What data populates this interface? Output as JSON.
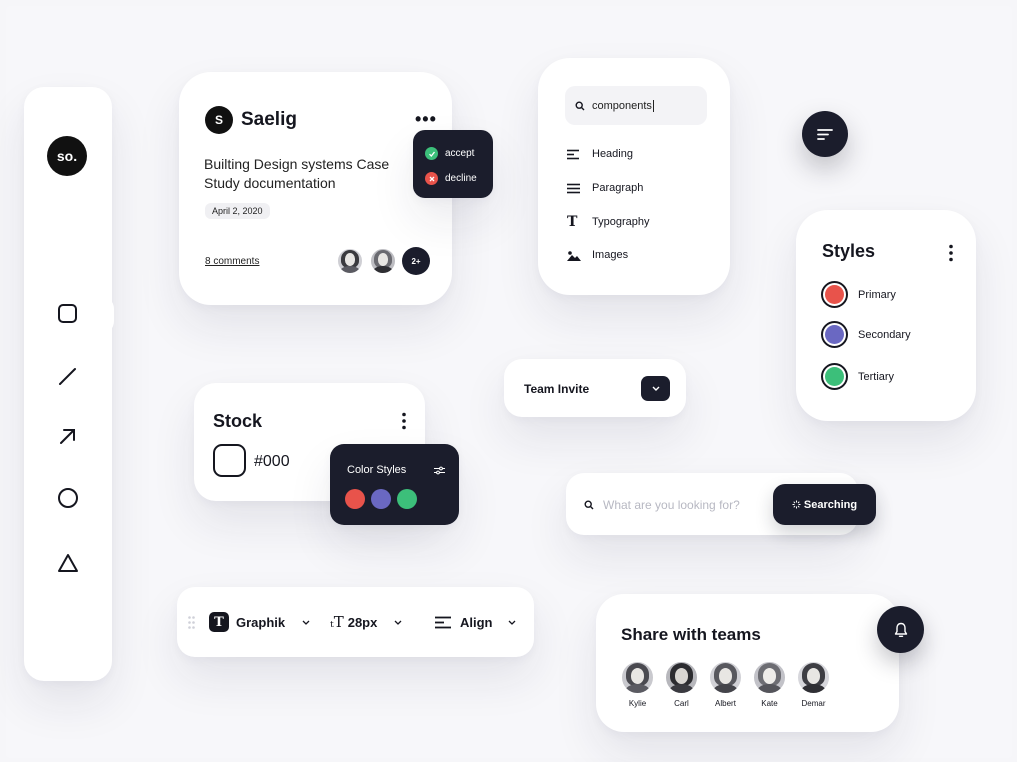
{
  "sidebar": {
    "logo": "so.",
    "tools": [
      {
        "name": "rectangle-tool",
        "icon": "square-icon"
      },
      {
        "name": "line-tool",
        "icon": "line-icon"
      },
      {
        "name": "arrow-tool",
        "icon": "arrow-icon"
      },
      {
        "name": "ellipse-tool",
        "icon": "circle-icon"
      },
      {
        "name": "triangle-tool",
        "icon": "triangle-icon"
      }
    ]
  },
  "post_card": {
    "brand_initial": "S",
    "brand_name": "Saelig",
    "title": "Builting Design systems Case Study documentation",
    "date": "April 2, 2020",
    "comments": "8 comments",
    "more_count": "2+"
  },
  "action_menu": {
    "accept": "accept",
    "decline": "decline",
    "accept_color": "#3cbf7a",
    "decline_color": "#e8534b"
  },
  "component_search": {
    "query": "components",
    "items": [
      {
        "label": "Heading",
        "icon": "heading-icon"
      },
      {
        "label": "Paragraph",
        "icon": "paragraph-icon"
      },
      {
        "label": "Typography",
        "icon": "typography-icon"
      },
      {
        "label": "Images",
        "icon": "image-icon"
      }
    ]
  },
  "styles_card": {
    "title": "Styles",
    "items": [
      {
        "label": "Primary",
        "color": "#e8534b"
      },
      {
        "label": "Secondary",
        "color": "#6a68c2"
      },
      {
        "label": "Tertiary",
        "color": "#3cbf7a"
      }
    ]
  },
  "stock_card": {
    "title": "Stock",
    "value": "#000"
  },
  "color_styles": {
    "title": "Color Styles",
    "swatches": [
      "#e8534b",
      "#6a68c2",
      "#3cbf7a"
    ]
  },
  "team_invite": {
    "label": "Team Invite"
  },
  "search_bar": {
    "placeholder": "What are you looking for?",
    "button": "Searching"
  },
  "typography_toolbar": {
    "font_icon_letter": "T",
    "font": "Graphik",
    "size_icon": "ₜT",
    "size": "28px",
    "align": "Align"
  },
  "share_card": {
    "title": "Share with teams",
    "members": [
      "Kylie",
      "Carl",
      "Albert",
      "Kate",
      "Demar"
    ]
  },
  "colors": {
    "dark": "#1b1d2c",
    "red": "#e8534b",
    "purple": "#6a68c2",
    "green": "#3cbf7a"
  }
}
